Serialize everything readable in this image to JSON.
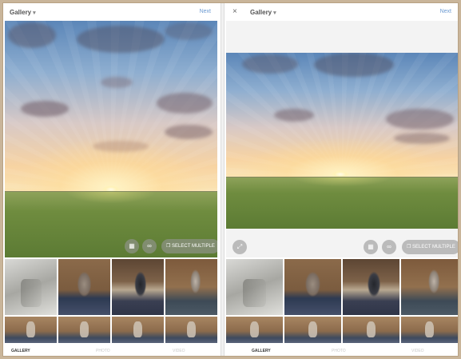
{
  "left_panel": {
    "title": "Gallery",
    "title_chevron": "▾",
    "next_label": "Next",
    "tools": {
      "layout_icon": "layout-icon",
      "boomerang_icon": "boomerang-icon",
      "multiple_select_label": "SELECT MULTIPLE"
    },
    "tabs": [
      "GALLERY",
      "PHOTO",
      "VIDEO"
    ]
  },
  "right_panel": {
    "close_icon": "×",
    "title": "Gallery",
    "title_chevron": "▾",
    "next_label": "Next",
    "tools": {
      "expand_icon": "expand-icon",
      "layout_icon": "layout-icon",
      "boomerang_icon": "boomerang-icon",
      "multiple_select_label": "SELECT MULTIPLE"
    },
    "tabs": [
      "GALLERY",
      "PHOTO",
      "VIDEO"
    ]
  },
  "colors": {
    "accent_link": "#6c9bd2",
    "frame_border": "#b8a284"
  }
}
